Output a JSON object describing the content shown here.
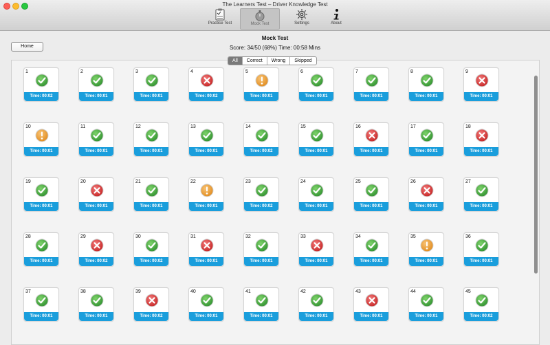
{
  "window": {
    "title": "The Learners Test – Driver Knowledge Test"
  },
  "toolbar": {
    "items": [
      {
        "label": "Practice Test",
        "icon": "clipboard-icon"
      },
      {
        "label": "Mock Test",
        "icon": "stopwatch-icon",
        "active": true
      },
      {
        "label": "Settings",
        "icon": "gear-icon"
      },
      {
        "label": "About",
        "icon": "info-icon"
      }
    ]
  },
  "header": {
    "home_label": "Home",
    "title": "Mock Test",
    "score_text": "Score: 34/50 (68%) Time: 00:58 Mins"
  },
  "filter": {
    "options": [
      "All",
      "Correct",
      "Wrong",
      "Skipped"
    ],
    "selected": "All"
  },
  "colors": {
    "accent": "#1a9edc",
    "correct": "#3aa63a",
    "wrong": "#d93b3b",
    "skipped": "#f0a030"
  },
  "questions": [
    {
      "num": "1",
      "status": "correct",
      "time": "Time: 00:02"
    },
    {
      "num": "2",
      "status": "correct",
      "time": "Time: 00:01"
    },
    {
      "num": "3",
      "status": "correct",
      "time": "Time: 00:01"
    },
    {
      "num": "4",
      "status": "wrong",
      "time": "Time: 00:02"
    },
    {
      "num": "5",
      "status": "skipped",
      "time": "Time: 00:01"
    },
    {
      "num": "6",
      "status": "correct",
      "time": "Time: 00:01"
    },
    {
      "num": "7",
      "status": "correct",
      "time": "Time: 00:01"
    },
    {
      "num": "8",
      "status": "correct",
      "time": "Time: 00:01"
    },
    {
      "num": "9",
      "status": "wrong",
      "time": "Time: 00:01"
    },
    {
      "num": "10",
      "status": "skipped",
      "time": "Time: 00:01"
    },
    {
      "num": "11",
      "status": "correct",
      "time": "Time: 00:01"
    },
    {
      "num": "12",
      "status": "correct",
      "time": "Time: 00:01"
    },
    {
      "num": "13",
      "status": "correct",
      "time": "Time: 00:01"
    },
    {
      "num": "14",
      "status": "correct",
      "time": "Time: 00:02"
    },
    {
      "num": "15",
      "status": "correct",
      "time": "Time: 00:01"
    },
    {
      "num": "16",
      "status": "wrong",
      "time": "Time: 00:01"
    },
    {
      "num": "17",
      "status": "correct",
      "time": "Time: 00:01"
    },
    {
      "num": "18",
      "status": "wrong",
      "time": "Time: 00:01"
    },
    {
      "num": "19",
      "status": "correct",
      "time": "Time: 00:01"
    },
    {
      "num": "20",
      "status": "wrong",
      "time": "Time: 00:01"
    },
    {
      "num": "21",
      "status": "correct",
      "time": "Time: 00:01"
    },
    {
      "num": "22",
      "status": "skipped",
      "time": "Time: 00:01"
    },
    {
      "num": "23",
      "status": "correct",
      "time": "Time: 00:02"
    },
    {
      "num": "24",
      "status": "correct",
      "time": "Time: 00:01"
    },
    {
      "num": "25",
      "status": "correct",
      "time": "Time: 00:01"
    },
    {
      "num": "26",
      "status": "wrong",
      "time": "Time: 00:01"
    },
    {
      "num": "27",
      "status": "correct",
      "time": "Time: 00:01"
    },
    {
      "num": "28",
      "status": "correct",
      "time": "Time: 00:01"
    },
    {
      "num": "29",
      "status": "wrong",
      "time": "Time: 00:02"
    },
    {
      "num": "30",
      "status": "correct",
      "time": "Time: 00:02"
    },
    {
      "num": "31",
      "status": "wrong",
      "time": "Time: 00:01"
    },
    {
      "num": "32",
      "status": "correct",
      "time": "Time: 00:01"
    },
    {
      "num": "33",
      "status": "wrong",
      "time": "Time: 00:01"
    },
    {
      "num": "34",
      "status": "correct",
      "time": "Time: 00:01"
    },
    {
      "num": "35",
      "status": "skipped",
      "time": "Time: 00:01"
    },
    {
      "num": "36",
      "status": "correct",
      "time": "Time: 00:01"
    },
    {
      "num": "37",
      "status": "correct",
      "time": "Time: 00:01"
    },
    {
      "num": "38",
      "status": "correct",
      "time": "Time: 00:01"
    },
    {
      "num": "39",
      "status": "wrong",
      "time": "Time: 00:02"
    },
    {
      "num": "40",
      "status": "correct",
      "time": "Time: 00:01"
    },
    {
      "num": "41",
      "status": "correct",
      "time": "Time: 00:01"
    },
    {
      "num": "42",
      "status": "correct",
      "time": "Time: 00:01"
    },
    {
      "num": "43",
      "status": "wrong",
      "time": "Time: 00:01"
    },
    {
      "num": "44",
      "status": "correct",
      "time": "Time: 00:01"
    },
    {
      "num": "45",
      "status": "correct",
      "time": "Time: 00:02"
    }
  ]
}
